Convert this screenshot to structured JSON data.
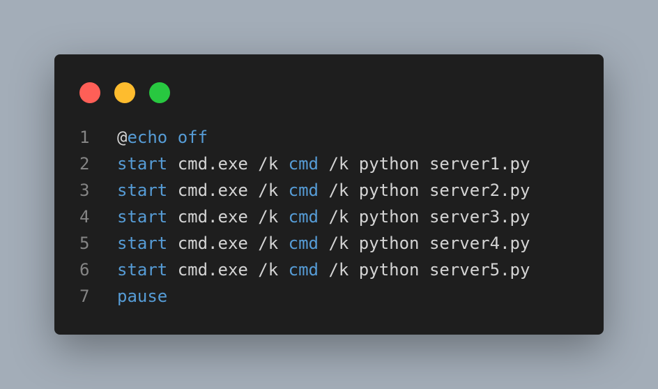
{
  "colors": {
    "background": "#a3adb8",
    "window": "#1e1e1e",
    "dot_red": "#ff5f57",
    "dot_yellow": "#febc2e",
    "dot_green": "#28c840",
    "keyword": "#569cd6",
    "text": "#d4d4d4",
    "line_number": "#858585"
  },
  "window_controls": {
    "close": "close-dot",
    "minimize": "minimize-dot",
    "maximize": "maximize-dot"
  },
  "code": {
    "lines": [
      {
        "number": "1",
        "tokens": [
          {
            "t": "@",
            "k": "text"
          },
          {
            "t": "echo",
            "k": "keyword"
          },
          {
            "t": " ",
            "k": "text"
          },
          {
            "t": "off",
            "k": "keyword"
          }
        ]
      },
      {
        "number": "2",
        "tokens": [
          {
            "t": "start",
            "k": "keyword"
          },
          {
            "t": " cmd.exe /k ",
            "k": "text"
          },
          {
            "t": "cmd",
            "k": "keyword"
          },
          {
            "t": " /k python server1.py",
            "k": "text"
          }
        ]
      },
      {
        "number": "3",
        "tokens": [
          {
            "t": "start",
            "k": "keyword"
          },
          {
            "t": " cmd.exe /k ",
            "k": "text"
          },
          {
            "t": "cmd",
            "k": "keyword"
          },
          {
            "t": " /k python server2.py",
            "k": "text"
          }
        ]
      },
      {
        "number": "4",
        "tokens": [
          {
            "t": "start",
            "k": "keyword"
          },
          {
            "t": " cmd.exe /k ",
            "k": "text"
          },
          {
            "t": "cmd",
            "k": "keyword"
          },
          {
            "t": " /k python server3.py",
            "k": "text"
          }
        ]
      },
      {
        "number": "5",
        "tokens": [
          {
            "t": "start",
            "k": "keyword"
          },
          {
            "t": " cmd.exe /k ",
            "k": "text"
          },
          {
            "t": "cmd",
            "k": "keyword"
          },
          {
            "t": " /k python server4.py",
            "k": "text"
          }
        ]
      },
      {
        "number": "6",
        "tokens": [
          {
            "t": "start",
            "k": "keyword"
          },
          {
            "t": " cmd.exe /k ",
            "k": "text"
          },
          {
            "t": "cmd",
            "k": "keyword"
          },
          {
            "t": " /k python server5.py",
            "k": "text"
          }
        ]
      },
      {
        "number": "7",
        "tokens": [
          {
            "t": "pause",
            "k": "keyword"
          }
        ]
      }
    ]
  }
}
